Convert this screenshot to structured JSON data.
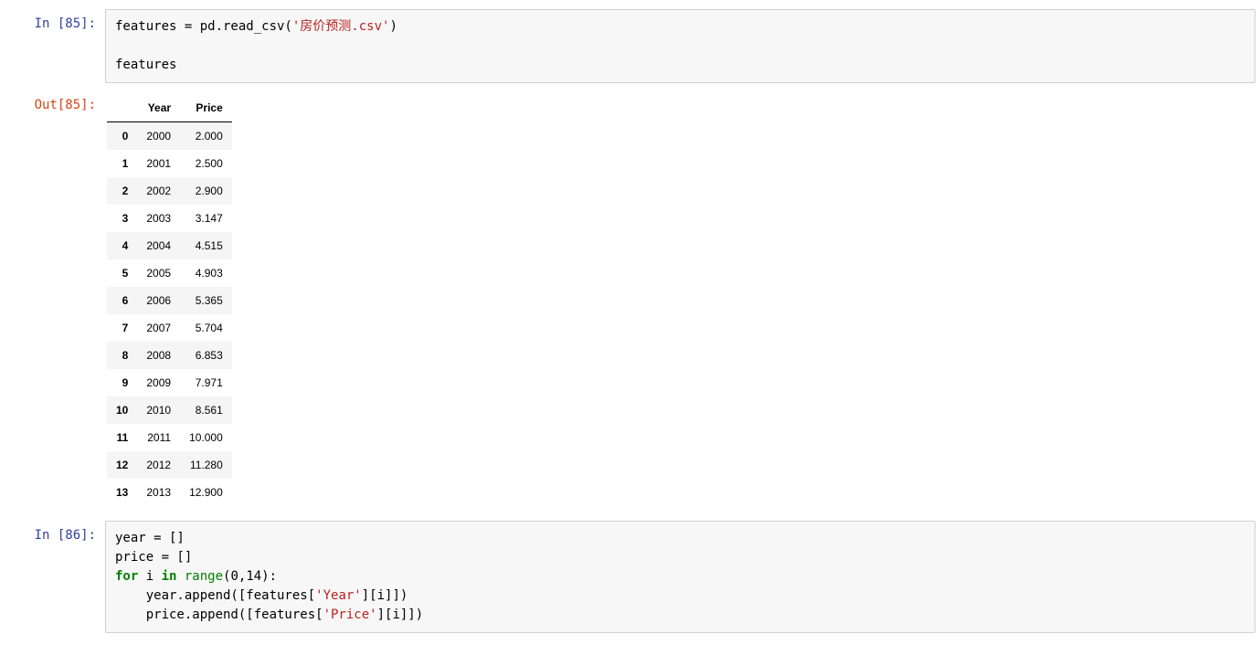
{
  "cell1": {
    "in_prompt": "In  [85]:",
    "out_prompt": "Out[85]:",
    "code_prefix": "features = pd.read_csv(",
    "code_str": "'房价预测.csv'",
    "code_suffix": ")",
    "code_blank": "",
    "code_line2": "features",
    "table": {
      "headers": {
        "idx": "",
        "year": "Year",
        "price": "Price"
      },
      "rows": [
        {
          "idx": "0",
          "year": "2000",
          "price": "2.000"
        },
        {
          "idx": "1",
          "year": "2001",
          "price": "2.500"
        },
        {
          "idx": "2",
          "year": "2002",
          "price": "2.900"
        },
        {
          "idx": "3",
          "year": "2003",
          "price": "3.147"
        },
        {
          "idx": "4",
          "year": "2004",
          "price": "4.515"
        },
        {
          "idx": "5",
          "year": "2005",
          "price": "4.903"
        },
        {
          "idx": "6",
          "year": "2006",
          "price": "5.365"
        },
        {
          "idx": "7",
          "year": "2007",
          "price": "5.704"
        },
        {
          "idx": "8",
          "year": "2008",
          "price": "6.853"
        },
        {
          "idx": "9",
          "year": "2009",
          "price": "7.971"
        },
        {
          "idx": "10",
          "year": "2010",
          "price": "8.561"
        },
        {
          "idx": "11",
          "year": "2011",
          "price": "10.000"
        },
        {
          "idx": "12",
          "year": "2012",
          "price": "11.280"
        },
        {
          "idx": "13",
          "year": "2013",
          "price": "12.900"
        }
      ]
    }
  },
  "cell2": {
    "in_prompt": "In  [86]:",
    "l1": "year = []",
    "l2": "price = []",
    "l3_for": "for",
    "l3_mid": " i ",
    "l3_in": "in",
    "l3_rng": " range",
    "l3_args": "(0,14):",
    "l4_pre": "    year.append([features[",
    "l4_str": "'Year'",
    "l4_suf": "][i]])",
    "l5_pre": "    price.append([features[",
    "l5_str": "'Price'",
    "l5_suf": "][i]])"
  }
}
